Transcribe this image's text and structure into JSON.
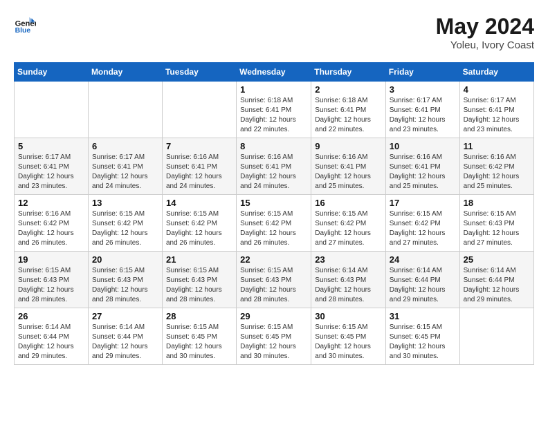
{
  "header": {
    "logo_line1": "General",
    "logo_line2": "Blue",
    "month_year": "May 2024",
    "location": "Yoleu, Ivory Coast"
  },
  "days_of_week": [
    "Sunday",
    "Monday",
    "Tuesday",
    "Wednesday",
    "Thursday",
    "Friday",
    "Saturday"
  ],
  "weeks": [
    [
      {
        "day": "",
        "sunrise": "",
        "sunset": "",
        "daylight": ""
      },
      {
        "day": "",
        "sunrise": "",
        "sunset": "",
        "daylight": ""
      },
      {
        "day": "",
        "sunrise": "",
        "sunset": "",
        "daylight": ""
      },
      {
        "day": "1",
        "sunrise": "Sunrise: 6:18 AM",
        "sunset": "Sunset: 6:41 PM",
        "daylight": "Daylight: 12 hours and 22 minutes."
      },
      {
        "day": "2",
        "sunrise": "Sunrise: 6:18 AM",
        "sunset": "Sunset: 6:41 PM",
        "daylight": "Daylight: 12 hours and 22 minutes."
      },
      {
        "day": "3",
        "sunrise": "Sunrise: 6:17 AM",
        "sunset": "Sunset: 6:41 PM",
        "daylight": "Daylight: 12 hours and 23 minutes."
      },
      {
        "day": "4",
        "sunrise": "Sunrise: 6:17 AM",
        "sunset": "Sunset: 6:41 PM",
        "daylight": "Daylight: 12 hours and 23 minutes."
      }
    ],
    [
      {
        "day": "5",
        "sunrise": "Sunrise: 6:17 AM",
        "sunset": "Sunset: 6:41 PM",
        "daylight": "Daylight: 12 hours and 23 minutes."
      },
      {
        "day": "6",
        "sunrise": "Sunrise: 6:17 AM",
        "sunset": "Sunset: 6:41 PM",
        "daylight": "Daylight: 12 hours and 24 minutes."
      },
      {
        "day": "7",
        "sunrise": "Sunrise: 6:16 AM",
        "sunset": "Sunset: 6:41 PM",
        "daylight": "Daylight: 12 hours and 24 minutes."
      },
      {
        "day": "8",
        "sunrise": "Sunrise: 6:16 AM",
        "sunset": "Sunset: 6:41 PM",
        "daylight": "Daylight: 12 hours and 24 minutes."
      },
      {
        "day": "9",
        "sunrise": "Sunrise: 6:16 AM",
        "sunset": "Sunset: 6:41 PM",
        "daylight": "Daylight: 12 hours and 25 minutes."
      },
      {
        "day": "10",
        "sunrise": "Sunrise: 6:16 AM",
        "sunset": "Sunset: 6:41 PM",
        "daylight": "Daylight: 12 hours and 25 minutes."
      },
      {
        "day": "11",
        "sunrise": "Sunrise: 6:16 AM",
        "sunset": "Sunset: 6:42 PM",
        "daylight": "Daylight: 12 hours and 25 minutes."
      }
    ],
    [
      {
        "day": "12",
        "sunrise": "Sunrise: 6:16 AM",
        "sunset": "Sunset: 6:42 PM",
        "daylight": "Daylight: 12 hours and 26 minutes."
      },
      {
        "day": "13",
        "sunrise": "Sunrise: 6:15 AM",
        "sunset": "Sunset: 6:42 PM",
        "daylight": "Daylight: 12 hours and 26 minutes."
      },
      {
        "day": "14",
        "sunrise": "Sunrise: 6:15 AM",
        "sunset": "Sunset: 6:42 PM",
        "daylight": "Daylight: 12 hours and 26 minutes."
      },
      {
        "day": "15",
        "sunrise": "Sunrise: 6:15 AM",
        "sunset": "Sunset: 6:42 PM",
        "daylight": "Daylight: 12 hours and 26 minutes."
      },
      {
        "day": "16",
        "sunrise": "Sunrise: 6:15 AM",
        "sunset": "Sunset: 6:42 PM",
        "daylight": "Daylight: 12 hours and 27 minutes."
      },
      {
        "day": "17",
        "sunrise": "Sunrise: 6:15 AM",
        "sunset": "Sunset: 6:42 PM",
        "daylight": "Daylight: 12 hours and 27 minutes."
      },
      {
        "day": "18",
        "sunrise": "Sunrise: 6:15 AM",
        "sunset": "Sunset: 6:43 PM",
        "daylight": "Daylight: 12 hours and 27 minutes."
      }
    ],
    [
      {
        "day": "19",
        "sunrise": "Sunrise: 6:15 AM",
        "sunset": "Sunset: 6:43 PM",
        "daylight": "Daylight: 12 hours and 28 minutes."
      },
      {
        "day": "20",
        "sunrise": "Sunrise: 6:15 AM",
        "sunset": "Sunset: 6:43 PM",
        "daylight": "Daylight: 12 hours and 28 minutes."
      },
      {
        "day": "21",
        "sunrise": "Sunrise: 6:15 AM",
        "sunset": "Sunset: 6:43 PM",
        "daylight": "Daylight: 12 hours and 28 minutes."
      },
      {
        "day": "22",
        "sunrise": "Sunrise: 6:15 AM",
        "sunset": "Sunset: 6:43 PM",
        "daylight": "Daylight: 12 hours and 28 minutes."
      },
      {
        "day": "23",
        "sunrise": "Sunrise: 6:14 AM",
        "sunset": "Sunset: 6:43 PM",
        "daylight": "Daylight: 12 hours and 28 minutes."
      },
      {
        "day": "24",
        "sunrise": "Sunrise: 6:14 AM",
        "sunset": "Sunset: 6:44 PM",
        "daylight": "Daylight: 12 hours and 29 minutes."
      },
      {
        "day": "25",
        "sunrise": "Sunrise: 6:14 AM",
        "sunset": "Sunset: 6:44 PM",
        "daylight": "Daylight: 12 hours and 29 minutes."
      }
    ],
    [
      {
        "day": "26",
        "sunrise": "Sunrise: 6:14 AM",
        "sunset": "Sunset: 6:44 PM",
        "daylight": "Daylight: 12 hours and 29 minutes."
      },
      {
        "day": "27",
        "sunrise": "Sunrise: 6:14 AM",
        "sunset": "Sunset: 6:44 PM",
        "daylight": "Daylight: 12 hours and 29 minutes."
      },
      {
        "day": "28",
        "sunrise": "Sunrise: 6:15 AM",
        "sunset": "Sunset: 6:45 PM",
        "daylight": "Daylight: 12 hours and 30 minutes."
      },
      {
        "day": "29",
        "sunrise": "Sunrise: 6:15 AM",
        "sunset": "Sunset: 6:45 PM",
        "daylight": "Daylight: 12 hours and 30 minutes."
      },
      {
        "day": "30",
        "sunrise": "Sunrise: 6:15 AM",
        "sunset": "Sunset: 6:45 PM",
        "daylight": "Daylight: 12 hours and 30 minutes."
      },
      {
        "day": "31",
        "sunrise": "Sunrise: 6:15 AM",
        "sunset": "Sunset: 6:45 PM",
        "daylight": "Daylight: 12 hours and 30 minutes."
      },
      {
        "day": "",
        "sunrise": "",
        "sunset": "",
        "daylight": ""
      }
    ]
  ]
}
